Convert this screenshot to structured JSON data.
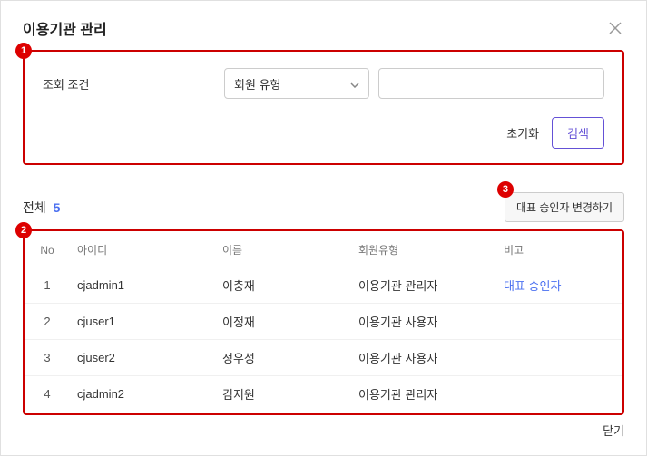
{
  "modal": {
    "title": "이용기관 관리",
    "close_button": "닫기"
  },
  "search": {
    "label": "조회 조건",
    "select_value": "회원 유형",
    "input_value": "",
    "reset_label": "초기화",
    "search_label": "검색"
  },
  "list": {
    "count_label": "전체",
    "count": "5",
    "change_button": "대표 승인자 변경하기"
  },
  "badges": {
    "b1": "1",
    "b2": "2",
    "b3": "3"
  },
  "table": {
    "headers": {
      "no": "No",
      "id": "아이디",
      "name": "이름",
      "type": "회원유형",
      "note": "비고"
    },
    "rows": [
      {
        "no": "1",
        "id": "cjadmin1",
        "name": "이충재",
        "type": "이용기관 관리자",
        "note": "대표 승인자",
        "note_link": true
      },
      {
        "no": "2",
        "id": "cjuser1",
        "name": "이정재",
        "type": "이용기관 사용자",
        "note": "",
        "note_link": false
      },
      {
        "no": "3",
        "id": "cjuser2",
        "name": "정우성",
        "type": "이용기관 사용자",
        "note": "",
        "note_link": false
      },
      {
        "no": "4",
        "id": "cjadmin2",
        "name": "김지원",
        "type": "이용기관 관리자",
        "note": "",
        "note_link": false
      }
    ]
  }
}
